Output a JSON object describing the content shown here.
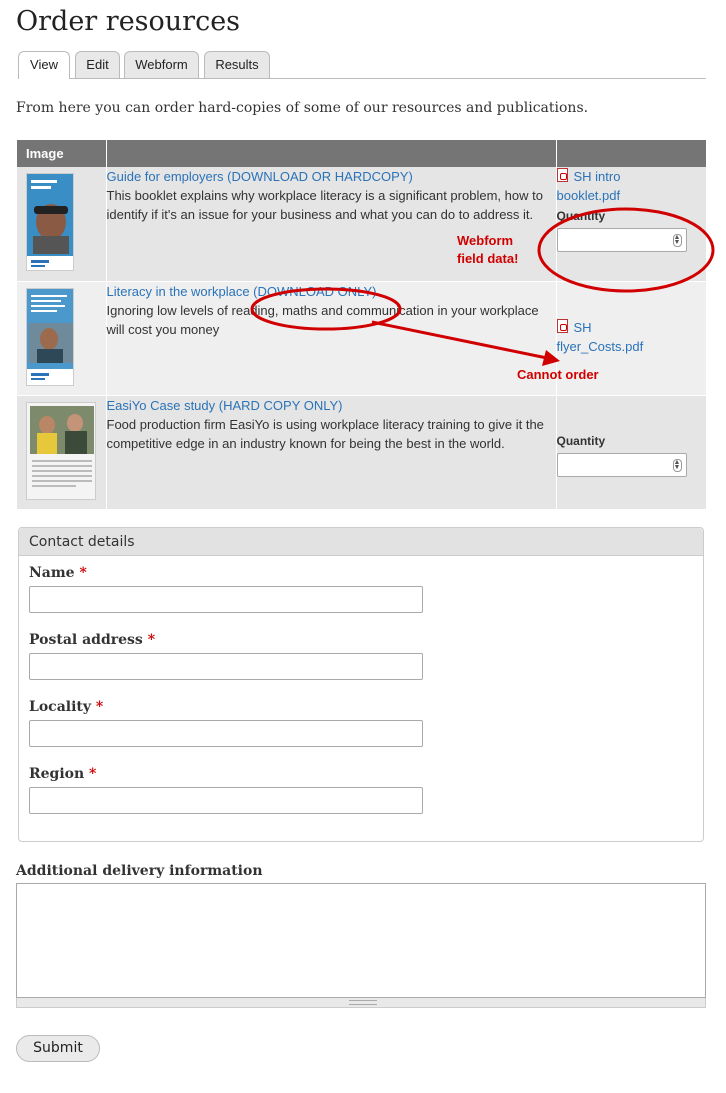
{
  "page": {
    "title": "Order resources"
  },
  "tabs": [
    {
      "label": "View",
      "active": true
    },
    {
      "label": "Edit"
    },
    {
      "label": "Webform"
    },
    {
      "label": "Results"
    }
  ],
  "intro": "From here you can order hard-copies of some of our resources and publications.",
  "table": {
    "columns": [
      "Image",
      "",
      ""
    ],
    "rows": [
      {
        "title": "Guide for employers (DOWNLOAD OR HARDCOPY)",
        "description": "This booklet explains why workplace literacy is a significant problem, how to identify if it's an issue for your business and what you can do to address it.",
        "file_line1": "SH intro",
        "file_line2": "booklet.pdf",
        "quantity_label": "Quantity",
        "quantity_value": ""
      },
      {
        "title": "Literacy in the workplace (DOWNLOAD ONLY)",
        "description": "Ignoring low levels of reading, maths and communication in your workplace will cost you money",
        "file_line1": "SH",
        "file_line2": "flyer_Costs.pdf"
      },
      {
        "title": "EasiYo Case study (HARD COPY ONLY)",
        "description": "Food production firm EasiYo is using workplace literacy training to give it the competitive edge in an industry known for being the best in the world.",
        "quantity_label": "Quantity",
        "quantity_value": ""
      }
    ]
  },
  "annotations": {
    "webform_line1": "Webform",
    "webform_line2": "field data!",
    "cannot_order": "Cannot order",
    "color": "#d10000"
  },
  "contact": {
    "legend": "Contact details",
    "fields": [
      {
        "label": "Name",
        "required": "*",
        "value": ""
      },
      {
        "label": "Postal address",
        "required": "*",
        "value": ""
      },
      {
        "label": "Locality",
        "required": "*",
        "value": ""
      },
      {
        "label": "Region",
        "required": "*",
        "value": ""
      }
    ]
  },
  "additional": {
    "label": "Additional delivery information",
    "value": ""
  },
  "submit_label": "Submit"
}
